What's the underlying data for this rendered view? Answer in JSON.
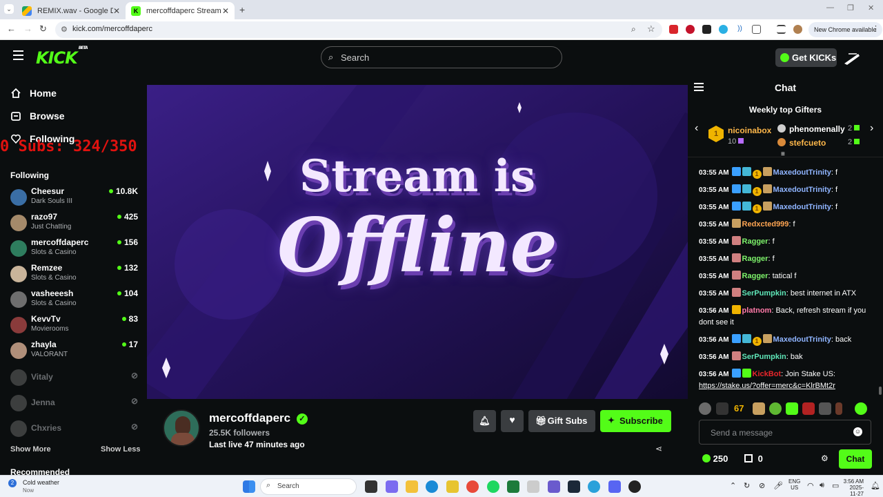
{
  "browser": {
    "tabs": [
      {
        "title": "REMIX.wav - Google Drive",
        "active": false
      },
      {
        "title": "mercoffdaperc Stream - Watch",
        "active": true
      }
    ],
    "url": "kick.com/mercoffdaperc",
    "new_chrome_label": "New Chrome available"
  },
  "header": {
    "logo": "KICK",
    "logo_badge": "BETA",
    "search_placeholder": "Search",
    "get_kicks": "Get KICKs"
  },
  "sidebar": {
    "nav": [
      {
        "label": "Home",
        "icon": "home-icon"
      },
      {
        "label": "Browse",
        "icon": "browse-icon"
      },
      {
        "label": "Following",
        "icon": "heart-icon"
      }
    ],
    "overlay_text": "0 Subs: 324/350",
    "following_heading": "Following",
    "following": [
      {
        "name": "Cheesur",
        "category": "Dark Souls III",
        "viewers": "10.8K",
        "live": true,
        "color": "#3a6ea5"
      },
      {
        "name": "razo97",
        "category": "Just Chatting",
        "viewers": "425",
        "live": true,
        "color": "#a58a6a"
      },
      {
        "name": "mercoffdaperc",
        "category": "Slots & Casino",
        "viewers": "156",
        "live": true,
        "color": "#2e7d5e"
      },
      {
        "name": "Remzee",
        "category": "Slots & Casino",
        "viewers": "132",
        "live": true,
        "color": "#c9b49a"
      },
      {
        "name": "vasheeesh",
        "category": "Slots & Casino",
        "viewers": "104",
        "live": true,
        "color": "#6e6e6e"
      },
      {
        "name": "KevvTv",
        "category": "Movierooms",
        "viewers": "83",
        "live": true,
        "color": "#8a3b3b"
      },
      {
        "name": "zhayla",
        "category": "VALORANT",
        "viewers": "17",
        "live": true,
        "color": "#b08f7a"
      },
      {
        "name": "Vitaly",
        "category": "",
        "viewers": "",
        "live": false,
        "color": "#999"
      },
      {
        "name": "Jenna",
        "category": "",
        "viewers": "",
        "live": false,
        "color": "#999"
      },
      {
        "name": "Chxries",
        "category": "",
        "viewers": "",
        "live": false,
        "color": "#999"
      }
    ],
    "show_more": "Show More",
    "show_less": "Show Less",
    "recommended_heading": "Recommended"
  },
  "player": {
    "line1": "Stream is",
    "line2": "Offline"
  },
  "channel": {
    "name": "mercoffdaperc",
    "followers": "25.5K followers",
    "last_live": "Last live 47 minutes ago",
    "gift_subs": "Gift Subs",
    "subscribe": "Subscribe"
  },
  "chat": {
    "title": "Chat",
    "gifters_title": "Weekly top Gifters",
    "top_gifter": {
      "name": "nicoinabox",
      "count": "10",
      "rank": "1"
    },
    "gifters": [
      {
        "name": "phenomenally",
        "count": "2"
      },
      {
        "name": "stefcueto",
        "count": "2"
      }
    ],
    "messages": [
      {
        "time": "03:55 AM",
        "user": "MaxedoutTrinity",
        "color": "#8fb4ff",
        "text": "f",
        "badges": [
          "#3aa0ff",
          "#44b7d6",
          "coin",
          "#c8a060"
        ]
      },
      {
        "time": "03:55 AM",
        "user": "MaxedoutTrinity",
        "color": "#8fb4ff",
        "text": "f",
        "badges": [
          "#3aa0ff",
          "#44b7d6",
          "coin",
          "#c8a060"
        ]
      },
      {
        "time": "03:55 AM",
        "user": "MaxedoutTrinity",
        "color": "#8fb4ff",
        "text": "f",
        "badges": [
          "#3aa0ff",
          "#44b7d6",
          "coin",
          "#c8a060"
        ]
      },
      {
        "time": "03:55 AM",
        "user": "Redxcted999",
        "color": "#ffa552",
        "text": "f",
        "badges": [
          "#c8a060"
        ]
      },
      {
        "time": "03:55 AM",
        "user": "Ragger",
        "color": "#7ef36b",
        "text": "f",
        "badges": [
          "#d08080"
        ]
      },
      {
        "time": "03:55 AM",
        "user": "Ragger",
        "color": "#7ef36b",
        "text": "f",
        "badges": [
          "#d08080"
        ]
      },
      {
        "time": "03:55 AM",
        "user": "Ragger",
        "color": "#7ef36b",
        "text": "tatical f",
        "badges": [
          "#d08080"
        ]
      },
      {
        "time": "03:55 AM",
        "user": "SerPumpkin",
        "color": "#5fe6b8",
        "text": "best internet in ATX",
        "badges": [
          "#d08080"
        ]
      },
      {
        "time": "03:56 AM",
        "user": "platnom",
        "color": "#ff7aa8",
        "text": "Back, refresh stream if you dont see it",
        "badges": [
          "#f0b400"
        ]
      },
      {
        "time": "03:56 AM",
        "user": "MaxedoutTrinity",
        "color": "#8fb4ff",
        "text": "back",
        "badges": [
          "#3aa0ff",
          "#44b7d6",
          "coin",
          "#c8a060"
        ]
      },
      {
        "time": "03:56 AM",
        "user": "SerPumpkin",
        "color": "#5fe6b8",
        "text": "bak",
        "badges": [
          "#d08080"
        ]
      },
      {
        "time": "03:56 AM",
        "user": "KickBot",
        "color": "#e8262b",
        "text": "Join Stake US:",
        "link": "https://stake.us/?offer=merc&c=KlrBMt2r",
        "badges": [
          "#3aa0ff",
          "#53fc18"
        ]
      }
    ],
    "emote_count": "67",
    "input_placeholder": "Send a message",
    "points": "250",
    "store_count": "0",
    "send_label": "Chat"
  },
  "taskbar": {
    "weather_title": "Cold weather",
    "weather_sub": "Now",
    "search_placeholder": "Search",
    "lang": "ENG",
    "region": "US",
    "time": "3:56 AM",
    "date": "2025-11-27"
  }
}
